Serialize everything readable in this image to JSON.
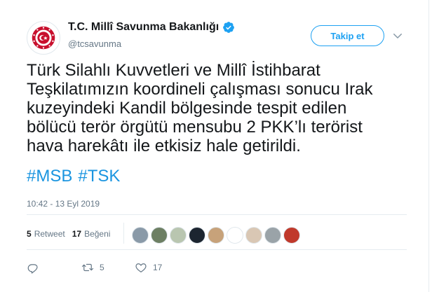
{
  "account": {
    "display_name": "T.C. Millî Savunma Bakanlığı",
    "handle": "@tcsavunma",
    "verified": true
  },
  "follow_button": {
    "label": "Takip et"
  },
  "tweet": {
    "text": "Türk Silahlı Kuvvetleri ve Millî İstihbarat\nTeşkilatımızın koordineli çalışması sonucu Irak\nkuzeyindeki Kandil bölgesinde tespit edilen\nbölücü terör örgütü mensubu 2 PKK’lı terörist\nhava harekâtı ile etkisiz hale getirildi.",
    "hashtags": [
      "#MSB",
      "#TSK"
    ],
    "timestamp": "10:42 - 13 Eyl 2019"
  },
  "stats": {
    "retweets_count": "5",
    "retweets_label": "Retweet",
    "likes_count": "17",
    "likes_label": "Beğeni"
  },
  "liker_avatars": [
    {
      "color": "#8a9aa8"
    },
    {
      "color": "#6d7f63"
    },
    {
      "color": "#b9c6b0"
    },
    {
      "color": "#1c2530"
    },
    {
      "color": "#c7a27a"
    },
    {
      "color": "#ffffff"
    },
    {
      "color": "#d9c7b4"
    },
    {
      "color": "#9aa3a8"
    },
    {
      "color": "#c0392b"
    }
  ],
  "actions": {
    "reply_icon": "reply-icon",
    "retweet_icon": "retweet-icon",
    "retweet_count": "5",
    "like_icon": "heart-icon",
    "like_count": "17"
  },
  "colors": {
    "accent": "#1da1f2",
    "hashtag": "#1b95e0",
    "verified": "#1da1f2",
    "muted": "#657786"
  }
}
